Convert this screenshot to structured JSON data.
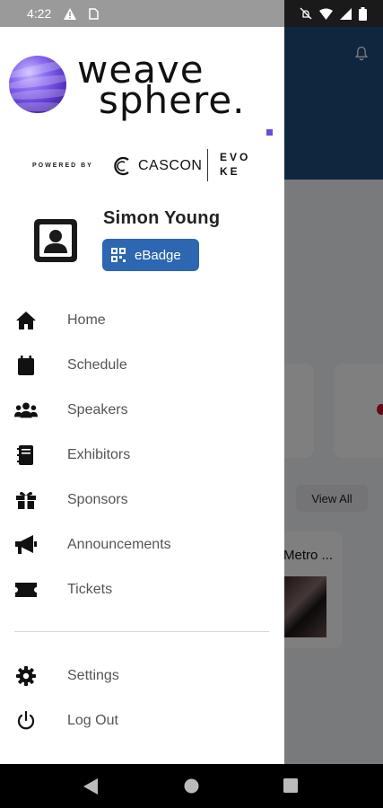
{
  "status_bar": {
    "time": "4:22"
  },
  "background": {
    "view_all_label": "View All",
    "event_title": "Metro ..."
  },
  "brand": {
    "word1": "weave",
    "word2": "sphere.",
    "powered_by": "POWERED BY",
    "partner1": "CASCON",
    "partner2_line1": "EVO",
    "partner2_line2": "KE",
    "accent_color": "#6a4be0"
  },
  "profile": {
    "name": "Simon Young",
    "badge_label": "eBadge",
    "badge_color": "#2d66b1"
  },
  "menu": {
    "items": [
      {
        "label": "Home",
        "icon": "home-icon"
      },
      {
        "label": "Schedule",
        "icon": "calendar-icon"
      },
      {
        "label": "Speakers",
        "icon": "users-icon"
      },
      {
        "label": "Exhibitors",
        "icon": "book-icon"
      },
      {
        "label": "Sponsors",
        "icon": "gift-icon"
      },
      {
        "label": "Announcements",
        "icon": "megaphone-icon"
      },
      {
        "label": "Tickets",
        "icon": "ticket-icon"
      }
    ],
    "footer_items": [
      {
        "label": "Settings",
        "icon": "gear-icon"
      },
      {
        "label": "Log Out",
        "icon": "power-icon"
      }
    ]
  },
  "header_color": "#1f4c7e"
}
